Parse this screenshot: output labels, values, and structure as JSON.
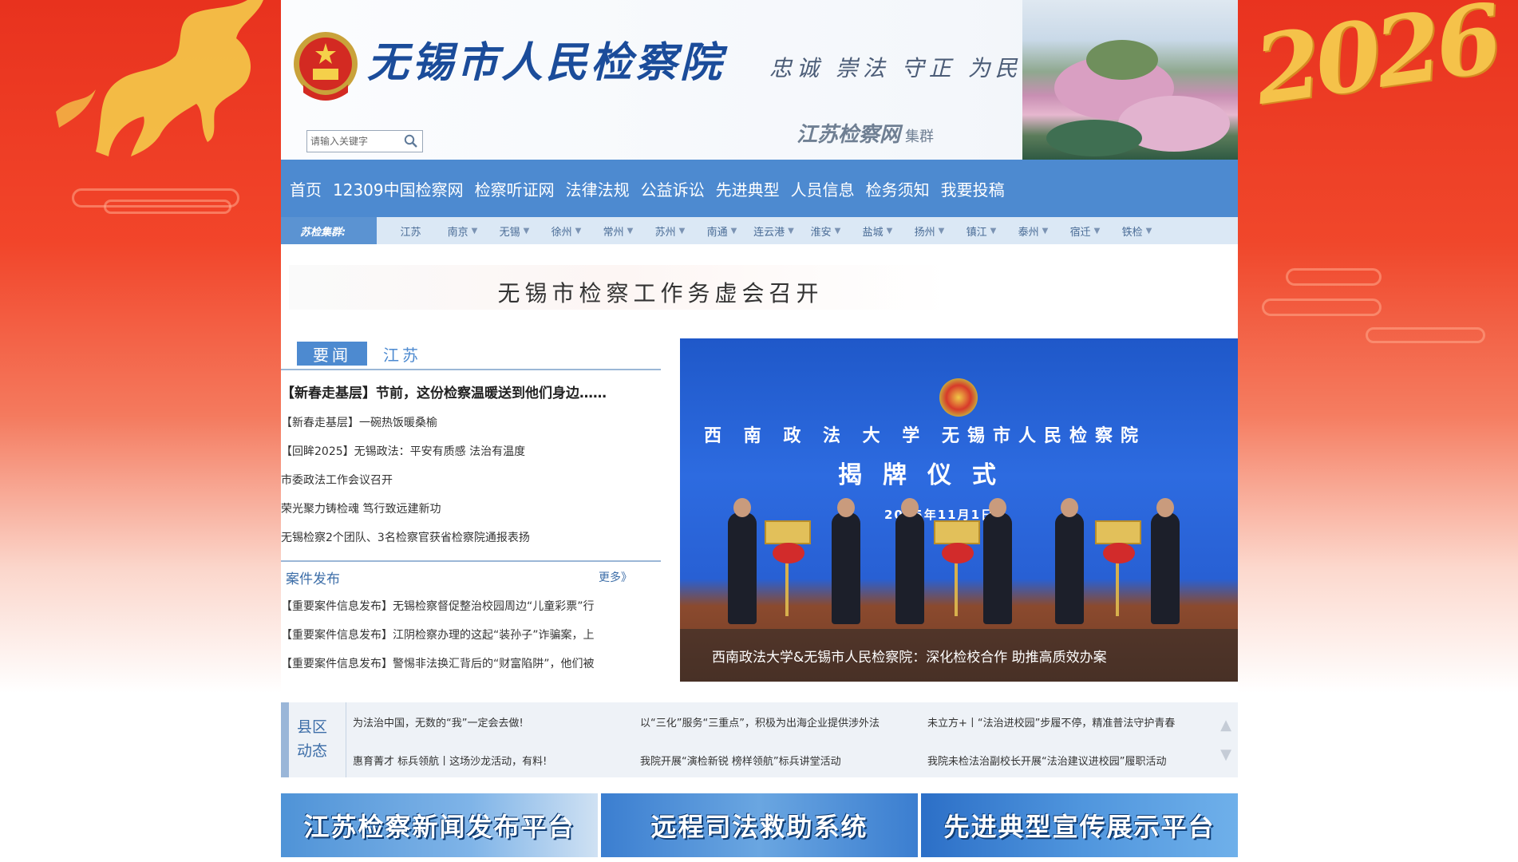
{
  "header": {
    "site_title": "无锡市人民检察院",
    "motto": "忠诚 崇法 守正 为民",
    "group_brand": "江苏检察网",
    "group_brand_suffix": "集群",
    "search": {
      "placeholder": "请输入关键字"
    }
  },
  "side_art": {
    "year": "2026"
  },
  "nav": {
    "items": [
      {
        "label": "首页"
      },
      {
        "label": "12309中国检察网"
      },
      {
        "label": "检察听证网"
      },
      {
        "label": "法律法规"
      },
      {
        "label": "公益诉讼"
      },
      {
        "label": "先进典型"
      },
      {
        "label": "人员信息"
      },
      {
        "label": "检务须知"
      },
      {
        "label": "我要投稿"
      }
    ]
  },
  "subnav": {
    "label": "苏检集群:",
    "items": [
      {
        "label": "江苏",
        "dropdown": false
      },
      {
        "label": "南京",
        "dropdown": true
      },
      {
        "label": "无锡",
        "dropdown": true
      },
      {
        "label": "徐州",
        "dropdown": true
      },
      {
        "label": "常州",
        "dropdown": true
      },
      {
        "label": "苏州",
        "dropdown": true
      },
      {
        "label": "南通",
        "dropdown": true
      },
      {
        "label": "连云港",
        "dropdown": true
      },
      {
        "label": "淮安",
        "dropdown": true
      },
      {
        "label": "盐城",
        "dropdown": true
      },
      {
        "label": "扬州",
        "dropdown": true
      },
      {
        "label": "镇江",
        "dropdown": true
      },
      {
        "label": "泰州",
        "dropdown": true
      },
      {
        "label": "宿迁",
        "dropdown": true
      },
      {
        "label": "铁检",
        "dropdown": true
      }
    ],
    "arrow": "▼"
  },
  "headline": "无锡市检察工作务虚会召开",
  "news": {
    "tabs": [
      {
        "label": "要闻",
        "active": true
      },
      {
        "label": "江苏",
        "active": false
      }
    ],
    "items": [
      "【新春走基层】节前，这份检察温暖送到他们身边……",
      "【新春走基层】一碗热饭暖桑榆",
      "【回眸2025】无锡政法：平安有质感 法治有温度",
      "市委政法工作会议召开",
      "荣光聚力铸检魂 笃行致远建新功",
      "无锡检察2个团队、3名检察官获省检察院通报表扬"
    ]
  },
  "cases": {
    "title": "案件发布",
    "more": "更多》",
    "items": [
      "【重要案件信息发布】无锡检察督促整治校园周边“儿童彩票”行",
      "【重要案件信息发布】江阴检察办理的这起“装孙子”诈骗案，上",
      "【重要案件信息发布】警惕非法换汇背后的“财富陷阱”，他们被"
    ]
  },
  "photo": {
    "line1": "西 南 政 法 大 学   无锡市人民检察院",
    "line2": "揭牌仪式",
    "date": "2025年11月1日",
    "caption": "西南政法大学&无锡市人民检察院：深化检校合作 助推高质效办案"
  },
  "county": {
    "label_line1": "县区",
    "label_line2": "动态",
    "items": [
      "为法治中国，无数的“我”一定会去做!",
      "以“三化”服务“三重点”，积极为出海企业提供涉外法",
      "未立方+丨“法治进校园”步履不停，精准普法守护青春",
      "惠育菁才 标兵领航丨这场沙龙活动，有料!",
      "我院开展“演检新锐 榜样领航”标兵讲堂活动",
      "我院未检法治副校长开展“法治建议进校园”履职活动"
    ],
    "scroll_up": "▲",
    "scroll_down": "▼"
  },
  "banners": [
    {
      "label": "江苏检察新闻发布平台"
    },
    {
      "label": "远程司法救助系统"
    },
    {
      "label": "先进典型宣传展示平台"
    }
  ],
  "colors": {
    "nav_bg": "#4d8ad0",
    "subnav_bg": "#dbe8f5",
    "title_blue": "#1b4c9a",
    "festive_red": "#e8321e"
  }
}
